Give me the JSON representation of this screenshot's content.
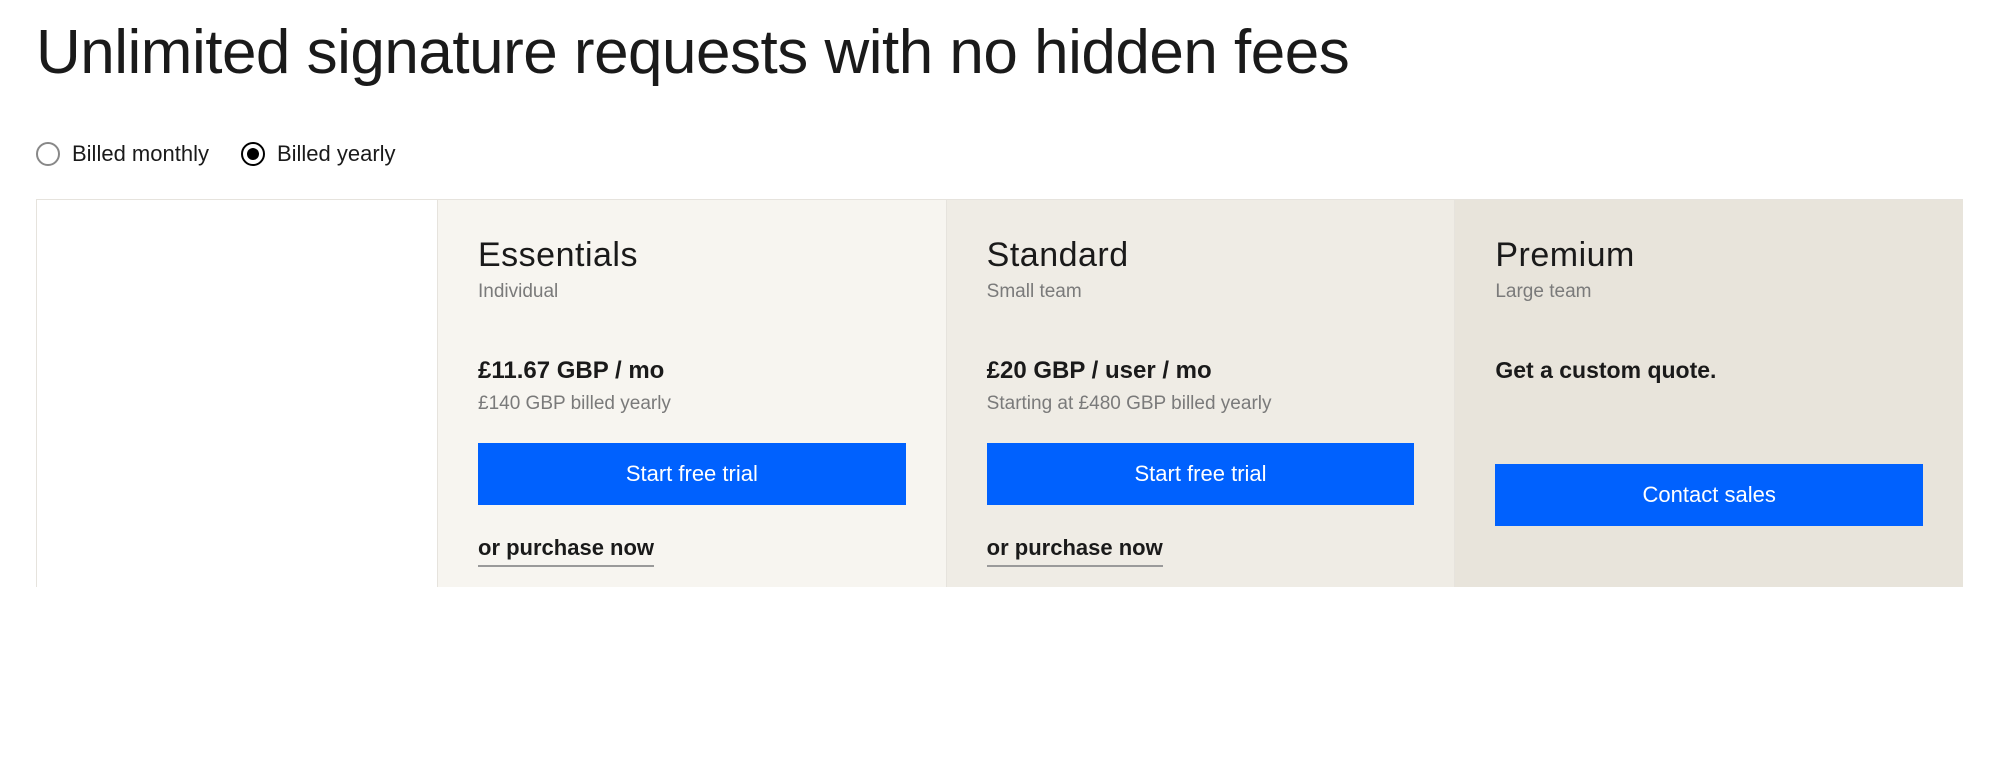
{
  "heading": "Unlimited signature requests with no hidden fees",
  "billing": {
    "monthly_label": "Billed monthly",
    "yearly_label": "Billed yearly",
    "selected": "yearly"
  },
  "plans": {
    "essentials": {
      "name": "Essentials",
      "audience": "Individual",
      "price": "£11.67 GBP / mo",
      "sub": "£140 GBP billed yearly",
      "cta": "Start free trial",
      "purchase": "or purchase now"
    },
    "standard": {
      "name": "Standard",
      "audience": "Small team",
      "price": "£20 GBP / user / mo",
      "sub": "Starting at £480 GBP billed yearly",
      "cta": "Start free trial",
      "purchase": "or purchase now"
    },
    "premium": {
      "name": "Premium",
      "audience": "Large team",
      "quote": "Get a custom quote.",
      "cta": "Contact sales"
    }
  }
}
